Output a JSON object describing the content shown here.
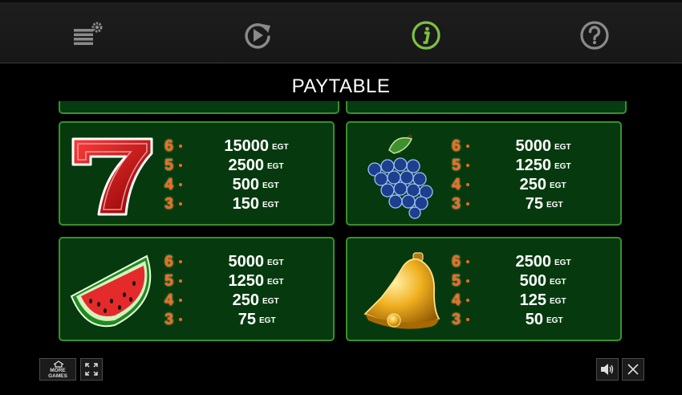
{
  "toolbar": {
    "items": [
      {
        "name": "settings",
        "icon": "bet-settings-icon"
      },
      {
        "name": "autoplay",
        "icon": "autoplay-icon"
      },
      {
        "name": "info",
        "icon": "info-icon",
        "active": true
      },
      {
        "name": "help",
        "icon": "help-icon"
      }
    ],
    "active_color": "#7cc242",
    "inactive_color": "#8a8a8a"
  },
  "title": "PAYTABLE",
  "paytable": [
    {
      "symbol": "seven",
      "pays": [
        {
          "count": "6",
          "value": "15000",
          "unit": "EGT"
        },
        {
          "count": "5",
          "value": "2500",
          "unit": "EGT"
        },
        {
          "count": "4",
          "value": "500",
          "unit": "EGT"
        },
        {
          "count": "3",
          "value": "150",
          "unit": "EGT"
        }
      ]
    },
    {
      "symbol": "grapes",
      "pays": [
        {
          "count": "6",
          "value": "5000",
          "unit": "EGT"
        },
        {
          "count": "5",
          "value": "1250",
          "unit": "EGT"
        },
        {
          "count": "4",
          "value": "250",
          "unit": "EGT"
        },
        {
          "count": "3",
          "value": "75",
          "unit": "EGT"
        }
      ]
    },
    {
      "symbol": "watermelon",
      "pays": [
        {
          "count": "6",
          "value": "5000",
          "unit": "EGT"
        },
        {
          "count": "5",
          "value": "1250",
          "unit": "EGT"
        },
        {
          "count": "4",
          "value": "250",
          "unit": "EGT"
        },
        {
          "count": "3",
          "value": "75",
          "unit": "EGT"
        }
      ]
    },
    {
      "symbol": "bell",
      "pays": [
        {
          "count": "6",
          "value": "2500",
          "unit": "EGT"
        },
        {
          "count": "5",
          "value": "500",
          "unit": "EGT"
        },
        {
          "count": "4",
          "value": "125",
          "unit": "EGT"
        },
        {
          "count": "3",
          "value": "50",
          "unit": "EGT"
        }
      ]
    }
  ],
  "footer": {
    "more_games_line1": "MORE",
    "more_games_line2": "GAMES",
    "fullscreen_icon": "fullscreen-icon",
    "sound_icon": "speaker-icon",
    "close_icon": "close-icon"
  },
  "colors": {
    "card_border": "#3b8e2e",
    "card_bg": "#063a0e",
    "count": "#f26a1d"
  }
}
